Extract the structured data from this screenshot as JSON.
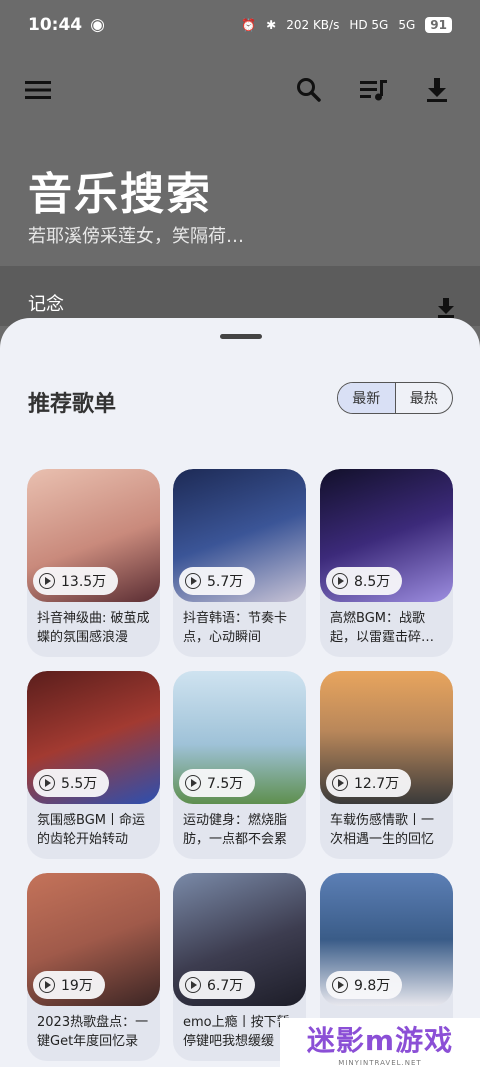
{
  "status": {
    "time": "10:44",
    "speed": "202 KB/s",
    "net1": "HD 5G",
    "net2": "5G",
    "battery": "91"
  },
  "header": {
    "title": "音乐搜索",
    "subtitle": "若耶溪傍采莲女，笑隔荷…"
  },
  "band": {
    "text": "记念"
  },
  "sheet": {
    "title": "推荐歌单",
    "tabs": [
      {
        "label": "最新"
      },
      {
        "label": "最热"
      }
    ]
  },
  "playlists": [
    {
      "plays": "13.5万",
      "title": "抖音神级曲: 破茧成蝶的氛围感浪漫",
      "cover": "#c98a7c"
    },
    {
      "plays": "5.7万",
      "title": "抖音韩语：节奏卡点，心动瞬间",
      "cover": "#2b3a66"
    },
    {
      "plays": "8.5万",
      "title": "高燃BGM：战歌起，以雷霆击碎…",
      "cover": "#2a1f55"
    },
    {
      "plays": "5.5万",
      "title": "氛围感BGM丨命运的齿轮开始转动",
      "cover": "#7a2f2a"
    },
    {
      "plays": "7.5万",
      "title": "运动健身：燃烧脂肪，一点都不会累",
      "cover": "#9fc2d8"
    },
    {
      "plays": "12.7万",
      "title": "车载伤感情歌丨一次相遇一生的回忆",
      "cover": "#b9875a"
    },
    {
      "plays": "19万",
      "title": "2023热歌盘点：一键Get年度回忆录",
      "cover": "#a05a4a"
    },
    {
      "plays": "6.7万",
      "title": "emo上瘾丨按下暂停键吧我想缓缓",
      "cover": "#3d3d50"
    },
    {
      "plays": "9.8万",
      "title": "",
      "cover": "#3a5c88"
    }
  ],
  "watermark": {
    "brand": "迷影m游戏",
    "url": "MINYINTRAVEL.NET"
  }
}
